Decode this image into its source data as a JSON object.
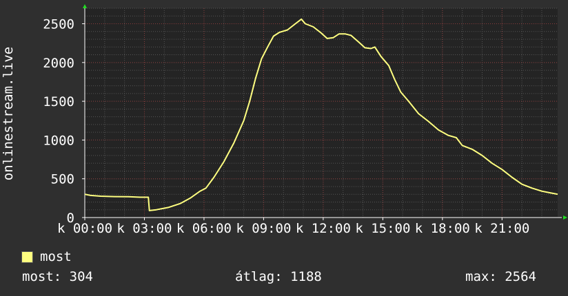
{
  "chart_data": {
    "type": "line",
    "ylabel": "onlinestream.live",
    "ylim": [
      0,
      2700
    ],
    "xlim": [
      0,
      23.8
    ],
    "grid": true,
    "y_ticks": [
      0,
      500,
      1000,
      1500,
      2000,
      2500
    ],
    "x_ticks": [
      {
        "value": 0,
        "label": "k 00:00"
      },
      {
        "value": 3,
        "label": "k 03:00"
      },
      {
        "value": 6,
        "label": "k 06:00"
      },
      {
        "value": 9,
        "label": "k 09:00"
      },
      {
        "value": 12,
        "label": "k 12:00"
      },
      {
        "value": 15,
        "label": "k 15:00"
      },
      {
        "value": 18,
        "label": "k 18:00"
      },
      {
        "value": 21,
        "label": "k 21:00"
      }
    ],
    "series": [
      {
        "name": "most",
        "color": "#ffff80",
        "points": [
          [
            0,
            300
          ],
          [
            0.3,
            285
          ],
          [
            0.8,
            275
          ],
          [
            1.5,
            270
          ],
          [
            2.2,
            268
          ],
          [
            2.8,
            262
          ],
          [
            3.2,
            262
          ],
          [
            3.25,
            90
          ],
          [
            3.6,
            100
          ],
          [
            4.2,
            130
          ],
          [
            4.8,
            180
          ],
          [
            5.3,
            250
          ],
          [
            5.8,
            340
          ],
          [
            6.1,
            380
          ],
          [
            6.5,
            520
          ],
          [
            7.0,
            720
          ],
          [
            7.5,
            960
          ],
          [
            8.0,
            1250
          ],
          [
            8.3,
            1500
          ],
          [
            8.6,
            1800
          ],
          [
            8.9,
            2050
          ],
          [
            9.2,
            2200
          ],
          [
            9.5,
            2340
          ],
          [
            9.8,
            2390
          ],
          [
            10.2,
            2420
          ],
          [
            10.6,
            2500
          ],
          [
            10.9,
            2560
          ],
          [
            11.1,
            2500
          ],
          [
            11.5,
            2460
          ],
          [
            11.9,
            2380
          ],
          [
            12.2,
            2310
          ],
          [
            12.5,
            2320
          ],
          [
            12.8,
            2370
          ],
          [
            13.1,
            2370
          ],
          [
            13.4,
            2350
          ],
          [
            13.8,
            2260
          ],
          [
            14.1,
            2190
          ],
          [
            14.4,
            2180
          ],
          [
            14.6,
            2200
          ],
          [
            14.9,
            2080
          ],
          [
            15.3,
            1960
          ],
          [
            15.6,
            1780
          ],
          [
            15.9,
            1620
          ],
          [
            16.3,
            1500
          ],
          [
            16.8,
            1340
          ],
          [
            17.3,
            1240
          ],
          [
            17.8,
            1130
          ],
          [
            18.3,
            1060
          ],
          [
            18.7,
            1030
          ],
          [
            19.0,
            930
          ],
          [
            19.5,
            880
          ],
          [
            20.0,
            800
          ],
          [
            20.5,
            700
          ],
          [
            21.0,
            620
          ],
          [
            21.5,
            520
          ],
          [
            22.0,
            430
          ],
          [
            22.5,
            380
          ],
          [
            23.0,
            340
          ],
          [
            23.4,
            320
          ],
          [
            23.8,
            300
          ]
        ]
      }
    ]
  },
  "legend": {
    "label": "most"
  },
  "stats": {
    "current": "most: 304",
    "average": "átlag: 1188",
    "maximum": "max: 2564"
  }
}
